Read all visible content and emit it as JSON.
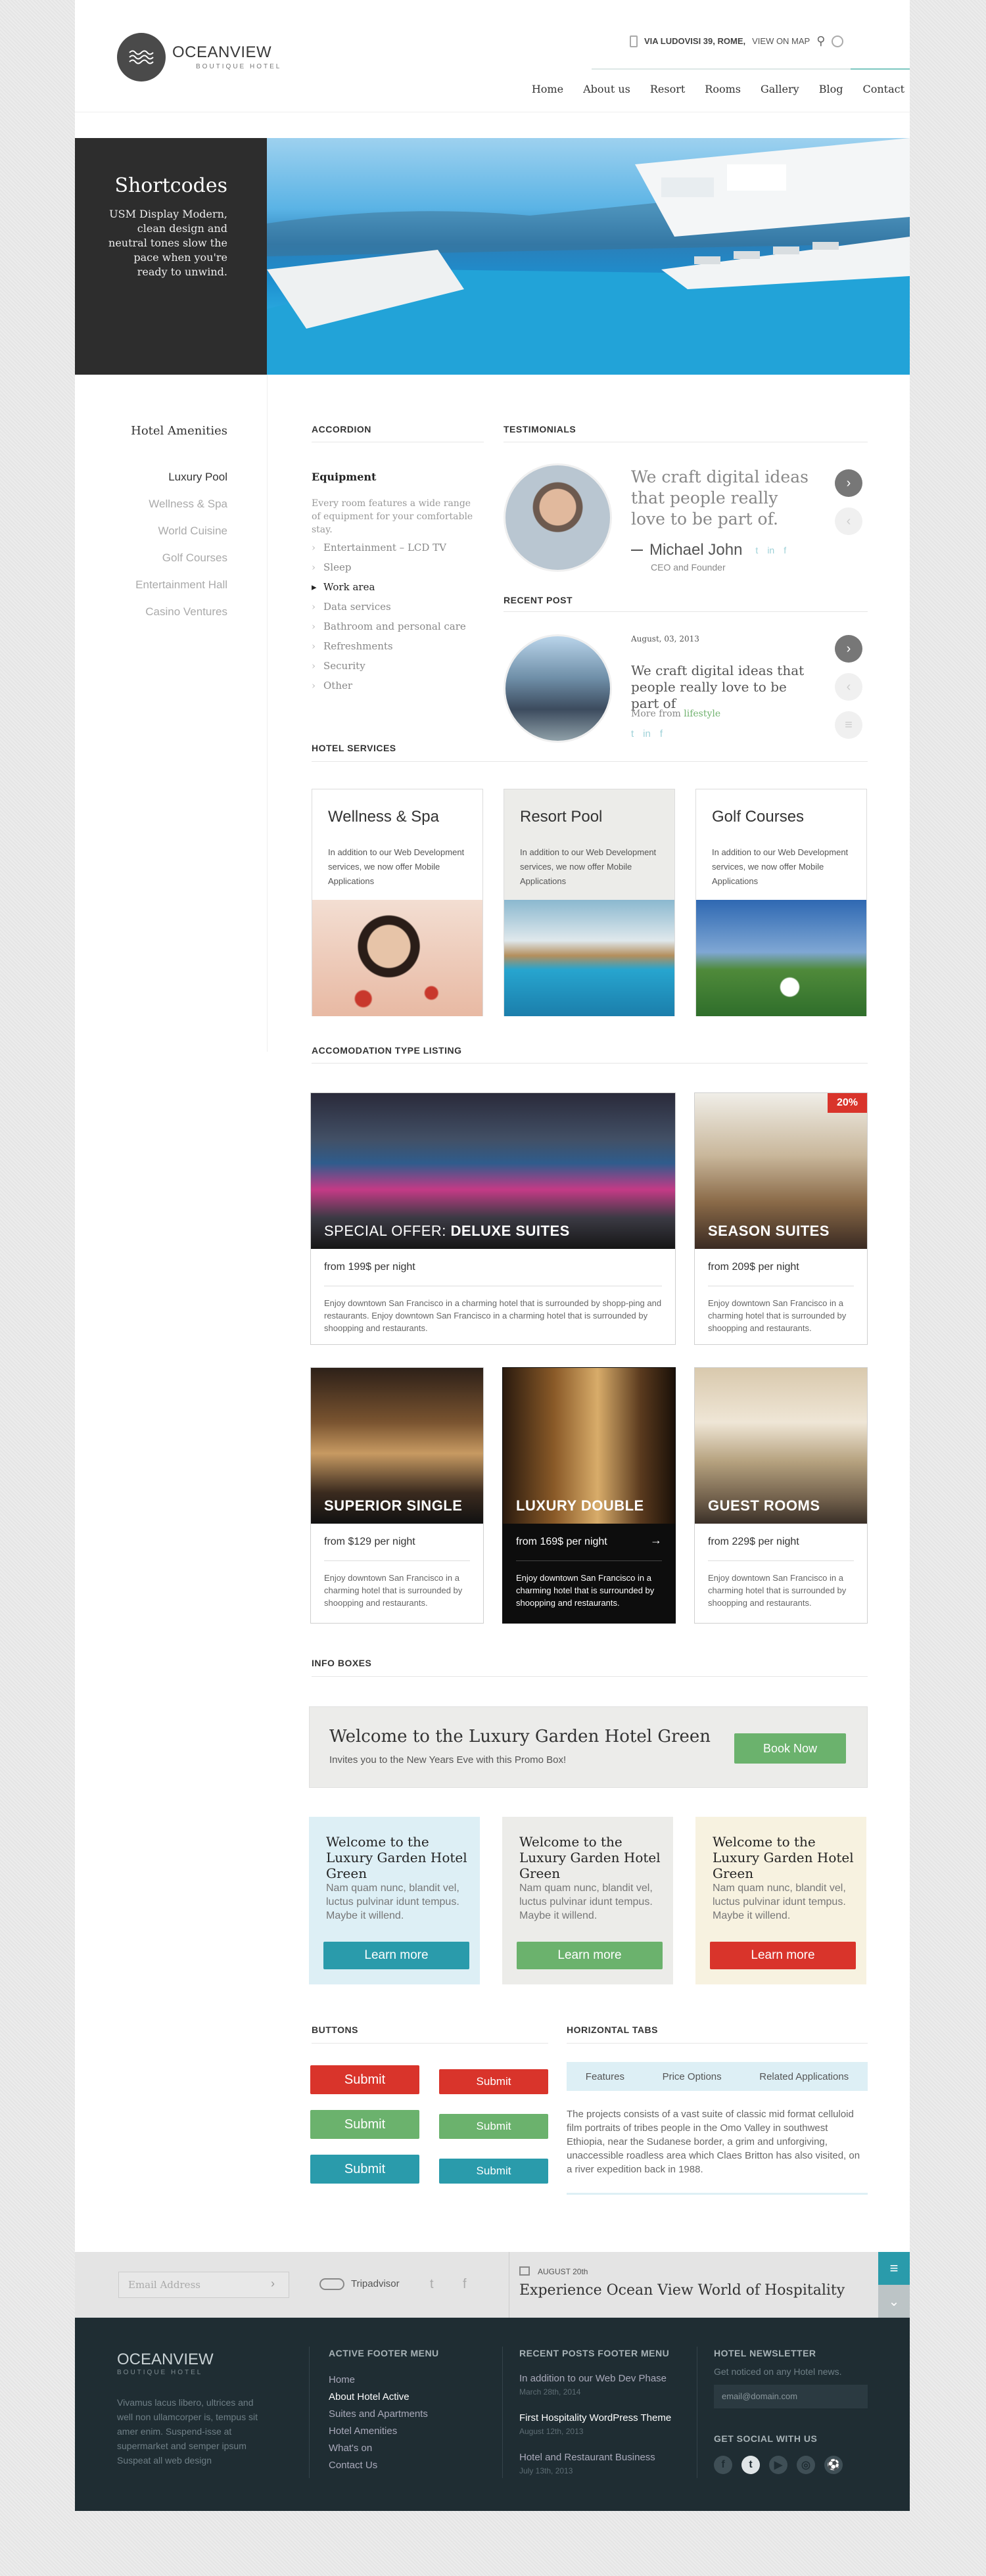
{
  "header": {
    "logo_name": "OCEANVIEW",
    "logo_sub": "BOUTIQUE HOTEL",
    "address_bold": "VIA LUDOVISI 39, ROME,",
    "address_link": "VIEW ON MAP",
    "nav": [
      "Home",
      "About us",
      "Resort",
      "Rooms",
      "Gallery",
      "Blog",
      "Contact"
    ]
  },
  "hero": {
    "title": "Shortcodes",
    "text": "USM Display Modern, clean design and neutral tones slow the pace when you're ready to unwind."
  },
  "sidebar": {
    "title": "Hotel Amenities",
    "items": [
      "Luxury Pool",
      "Wellness & Spa",
      "World Cuisine",
      "Golf Courses",
      "Entertainment Hall",
      "Casino Ventures"
    ]
  },
  "accordion": {
    "heading": "ACCORDION",
    "title": "Equipment",
    "desc": "Every room features a wide range of equipment for your comfortable stay.",
    "items": [
      "Entertainment – LCD TV",
      "Sleep",
      "Work area",
      "Data services",
      "Bathroom and personal care",
      "Refreshments",
      "Security",
      "Other"
    ],
    "active_index": 2
  },
  "testimonials": {
    "heading": "TESTIMONIALS",
    "quote": "We craft digital ideas that people really love to be part of.",
    "name": "Michael John",
    "role": "CEO and Founder"
  },
  "recent_post": {
    "heading": "RECENT POST",
    "date": "August, 03, 2013",
    "title": "We craft digital ideas that people really love to be part of",
    "more_prefix": "More from",
    "more_link": "lifestyle"
  },
  "services": {
    "heading": "HOTEL SERVICES",
    "items": [
      {
        "title": "Wellness & Spa",
        "desc": "In addition to our Web Development services, we now offer Mobile Applications"
      },
      {
        "title": "Resort Pool",
        "desc": "In addition to our Web Development services, we now offer Mobile Applications"
      },
      {
        "title": "Golf Courses",
        "desc": "In addition to our Web Development services, we now offer Mobile Applications"
      }
    ]
  },
  "accommodation": {
    "heading": "ACCOMODATION TYPE LISTING",
    "featured": {
      "name_prefix": "SPECIAL OFFER: ",
      "name": "DELUXE SUITES",
      "price": "from 199$ per night",
      "desc": "Enjoy downtown San Francisco in a charming hotel that is surrounded by shopp-ping and restaurants. Enjoy downtown San Francisco in a charming hotel that is surrounded by shoopping and restaurants."
    },
    "rooms": [
      {
        "name": "SEASON SUITES",
        "price": "from 209$ per night",
        "desc": "Enjoy downtown San Francisco in a charming hotel that is surrounded by shoopping and restaurants.",
        "badge": "20%"
      },
      {
        "name": "SUPERIOR SINGLE",
        "price": "from $129 per night",
        "desc": "Enjoy downtown San Francisco in a charming hotel that is surrounded by shoopping and restaurants."
      },
      {
        "name": "LUXURY DOUBLE",
        "price": "from 169$ per night",
        "desc": "Enjoy downtown San Francisco in a charming hotel that is surrounded by shoopping and restaurants."
      },
      {
        "name": "GUEST ROOMS",
        "price": "from 229$ per night",
        "desc": "Enjoy downtown San Francisco in a charming hotel that is surrounded by shoopping and restaurants."
      }
    ]
  },
  "info": {
    "heading": "INFO BOXES",
    "promo_title": "Welcome to the Luxury Garden Hotel Green",
    "promo_sub": "Invites you to the New Years Eve with this Promo Box!",
    "promo_button": "Book Now",
    "boxes": [
      {
        "title": "Welcome to the Luxury Garden Hotel Green",
        "desc": "Nam quam nunc, blandit vel, luctus pulvinar idunt tempus. Maybe it willend.",
        "button": "Learn more"
      },
      {
        "title": "Welcome to the Luxury Garden Hotel Green",
        "desc": "Nam quam nunc, blandit vel, luctus pulvinar idunt tempus. Maybe it willend.",
        "button": "Learn more"
      },
      {
        "title": "Welcome to the Luxury Garden Hotel Green",
        "desc": "Nam quam nunc, blandit vel, luctus pulvinar idunt tempus. Maybe it willend.",
        "button": "Learn more"
      }
    ]
  },
  "buttons": {
    "heading": "BUTTONS",
    "label": "Submit"
  },
  "tabs": {
    "heading": "HORIZONTAL TABS",
    "items": [
      "Features",
      "Price Options",
      "Related Applications"
    ],
    "content": "The projects consists of a vast suite of classic mid format celluloid film portraits of tribes people in the Omo Valley in southwest Ethiopia, near the Sudanese border, a grim and unforgiving, unaccessible roadless area which Claes Britton has also visited, on a river expedition back in 1988."
  },
  "subscribe": {
    "email_placeholder": "Email Address",
    "tripadvisor": "Tripadvisor",
    "event_date": "AUGUST 20th",
    "event_title": "Experience Ocean View World of Hospitality"
  },
  "footer": {
    "logo_name": "OCEANVIEW",
    "logo_sub": "BOUTIQUE HOTEL",
    "about": "Vivamus lacus libero, ultrices and well non ullamcorper is, tempus sit amer enim. Suspend-isse at supermarket and semper ipsum Suspeat all web design",
    "menu_heading": "ACTIVE FOOTER MENU",
    "menu": [
      "Home",
      "About Hotel Active",
      "Suites and Apartments",
      "Hotel Amenities",
      "What's on",
      "Contact Us"
    ],
    "posts_heading": "RECENT POSTS FOOTER MENU",
    "posts": [
      {
        "title": "In addition to our Web Dev Phase",
        "date": "March 28th, 2014"
      },
      {
        "title": "First Hospitality WordPress Theme",
        "date": "August 12th, 2013"
      },
      {
        "title": "Hotel and Restaurant Business",
        "date": "July 13th, 2013"
      }
    ],
    "newsletter_heading": "HOTEL NEWSLETTER",
    "newsletter_text": "Get noticed on any Hotel news.",
    "newsletter_placeholder": "email@domain.com",
    "social_heading": "GET SOCIAL WITH US"
  },
  "colors": {
    "teal": "#2a9bab",
    "green": "#6bb26d",
    "red": "#d9342b",
    "dark": "#1f2d33"
  }
}
